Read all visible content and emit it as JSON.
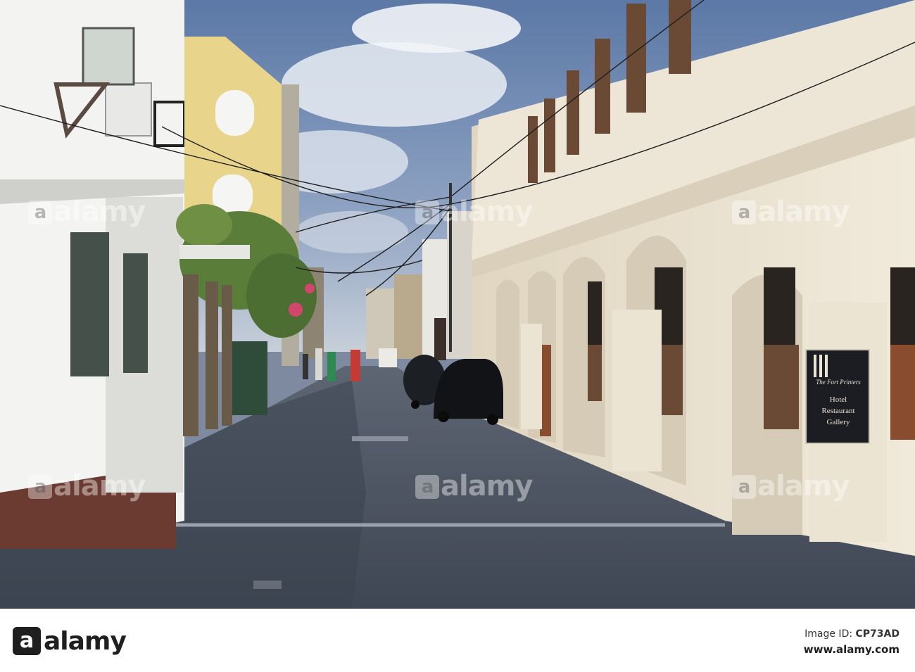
{
  "watermark": {
    "mark": "a",
    "word": "alamy"
  },
  "storefront_sign": {
    "title": "The Fort Printers",
    "lines": [
      "Hotel",
      "Restaurant",
      "Gallery"
    ]
  },
  "car_plate": "⬛⬛⬛⬛",
  "footer": {
    "logo_mark": "a",
    "logo_word": "alamy",
    "image_id_label": "Image ID: ",
    "image_id": "CP73AD",
    "url": "www.alamy.com"
  },
  "colors": {
    "sky": "#6d86ad",
    "cream_building": "#ece4d3",
    "yellow_building": "#e8d48b",
    "white_building": "#f3f3f1",
    "road": "#4a5260",
    "foliage": "#5a7d3a"
  }
}
